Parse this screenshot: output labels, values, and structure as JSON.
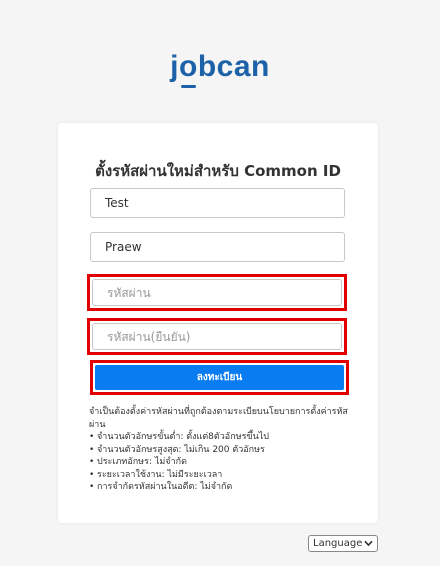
{
  "logo": {
    "text_before": "j",
    "text_o": "o",
    "text_after": "bcan"
  },
  "form": {
    "title": "ตั้งรหัสผ่านใหม่สำหรับ Common ID",
    "first_name_value": "Test",
    "last_name_value": "Praew",
    "password_placeholder": "รหัสผ่าน",
    "password_confirm_placeholder": "รหัสผ่าน(ยืนยัน)",
    "submit_label": "ลงทะเบียน"
  },
  "rules": {
    "intro": "จำเป็นต้องตั้งค่ารหัสผ่านที่ถูกต้องตามระเบียบนโยบายการตั้งค่ารหัสผ่าน",
    "items": [
      "จำนวนตัวอักษรขั้นต่ำ: ตั้งแต่8ตัวอักษรขึ้นไป",
      "จำนวนตัวอักษรสูงสุด: ไม่เกิน 200 ตัวอักษร",
      "ประเภทอักษร: ไม่จำกัด",
      "ระยะเวลาใช้งาน: ไม่มีระยะเวลา",
      "การจำกัดรหัสผ่านในอดีต: ไม่จำกัด"
    ]
  },
  "language": {
    "label": "Language",
    "icon": "chevron-down-icon"
  },
  "colors": {
    "brand": "#1d62a8",
    "button": "#0a7cf2",
    "highlight": "#e00000"
  }
}
